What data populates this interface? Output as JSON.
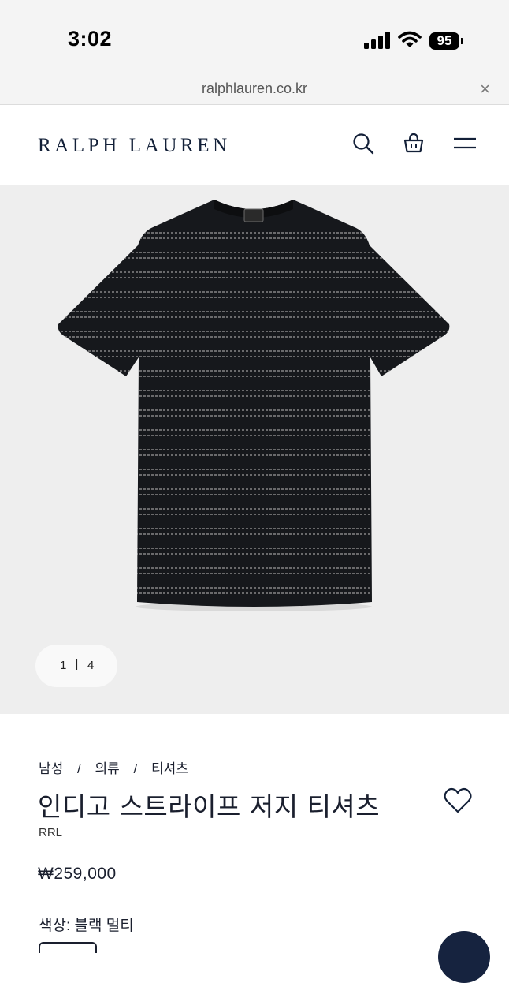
{
  "status_bar": {
    "time": "3:02",
    "battery": "95"
  },
  "browser": {
    "url": "ralphlauren.co.kr",
    "close_glyph": "×"
  },
  "header": {
    "logo": "RALPH LAUREN",
    "icons": [
      "search-icon",
      "shopping-bag-icon",
      "menu-icon"
    ]
  },
  "gallery": {
    "image_alt": "striped t-shirt product image",
    "current": "1",
    "divider": "|",
    "total": "4"
  },
  "product": {
    "breadcrumbs": [
      "남성",
      "의류",
      "티셔츠"
    ],
    "breadcrumb_separator": "/",
    "title": "인디고 스트라이프 저지 티셔츠",
    "brand": "RRL",
    "price": "₩259,000",
    "color_label": "색상:",
    "color_value": "블랙 멀티"
  },
  "colors": {
    "navy": "#132038",
    "gallery_bg": "#eeeeee",
    "shirt": "#16181c",
    "stripe": "#9a9a9a"
  }
}
